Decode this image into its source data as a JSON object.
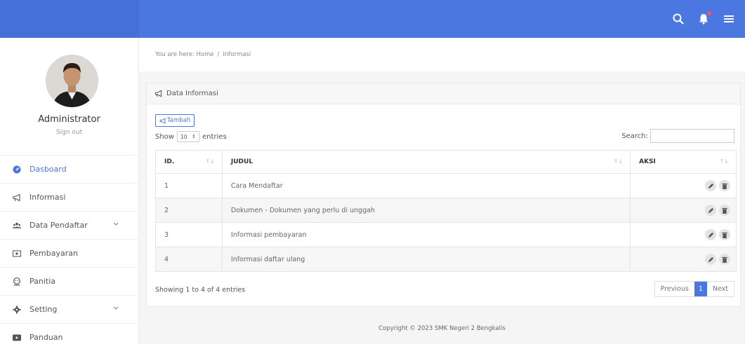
{
  "header": {
    "icons": [
      "search-icon",
      "bell-icon",
      "menu-icon"
    ],
    "accent": "#4a78e0"
  },
  "profile": {
    "name": "Administrator",
    "signout": "Sign out"
  },
  "sidebar": {
    "items": [
      {
        "label": "Dasboard",
        "icon": "dashboard-icon",
        "active": true
      },
      {
        "label": "Informasi",
        "icon": "megaphone-icon"
      },
      {
        "label": "Data Pendaftar",
        "icon": "users-icon",
        "expandable": true
      },
      {
        "label": "Pembayaran",
        "icon": "money-icon"
      },
      {
        "label": "Panitia",
        "icon": "user-icon"
      },
      {
        "label": "Setting",
        "icon": "gear-icon",
        "expandable": true
      },
      {
        "label": "Panduan",
        "icon": "video-icon"
      }
    ]
  },
  "breadcrumb": {
    "prefix": "You are here:",
    "home": "Home",
    "separator": "/",
    "current": "Informasi"
  },
  "panel": {
    "title": "Data Informasi",
    "add_label": "Tambah",
    "show_label": "Show",
    "entries_value": "10",
    "entries_label": "entries",
    "search_label": "Search:",
    "search_value": ""
  },
  "table": {
    "columns": [
      "ID.",
      "JUDUL",
      "AKSI"
    ],
    "rows": [
      {
        "id": "1",
        "judul": "Cara Mendaftar"
      },
      {
        "id": "2",
        "judul": "Dokumen - Dokumen yang perlu di unggah"
      },
      {
        "id": "3",
        "judul": "Informasi pembayaran"
      },
      {
        "id": "4",
        "judul": "Informasi daftar ulang"
      }
    ]
  },
  "pagination": {
    "info": "Showing 1 to 4 of 4 entries",
    "previous": "Previous",
    "current": "1",
    "next": "Next"
  },
  "footer": {
    "copyright": "Copyright © 2023 SMK Negeri 2 Bengkalis"
  }
}
